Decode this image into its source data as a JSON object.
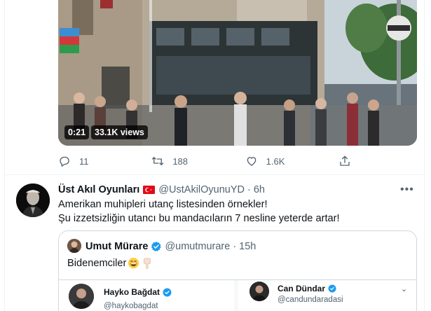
{
  "video_tweet": {
    "duration": "0:21",
    "views": "33.1K views",
    "actions": {
      "reply_count": "11",
      "retweet_count": "188",
      "like_count": "1.6K"
    }
  },
  "tweet": {
    "display_name": "Üst Akıl Oyunları",
    "handle": "@UstAkilOyunuYD",
    "dot": "·",
    "time": "6h",
    "more": "•••",
    "text_lines": [
      "Amerikan muhipleri utanç listesinden örnekler!",
      "Şu izzetsizliğin utancı bu mandacıların 7 nesline yeterde artar!"
    ]
  },
  "quote": {
    "display_name": "Umut Mürare",
    "handle": "@umutmurare",
    "dot": "·",
    "time": "15h",
    "text": "Bidenemciler",
    "cards": [
      {
        "name": "Hayko Bağdat",
        "handle": "@haykobagdat"
      },
      {
        "name": "Can Dündar",
        "handle": "@candundaradasi"
      }
    ]
  },
  "colors": {
    "accent": "#1d9bf0",
    "secondary_text": "#536471",
    "border": "#cfd9de"
  },
  "icons": [
    "reply-icon",
    "retweet-icon",
    "like-icon",
    "share-icon",
    "turkey-flag-icon",
    "verified-icon",
    "grinning-emoji-icon",
    "hand-pointing-down-emoji-icon",
    "chevron-down-icon"
  ]
}
